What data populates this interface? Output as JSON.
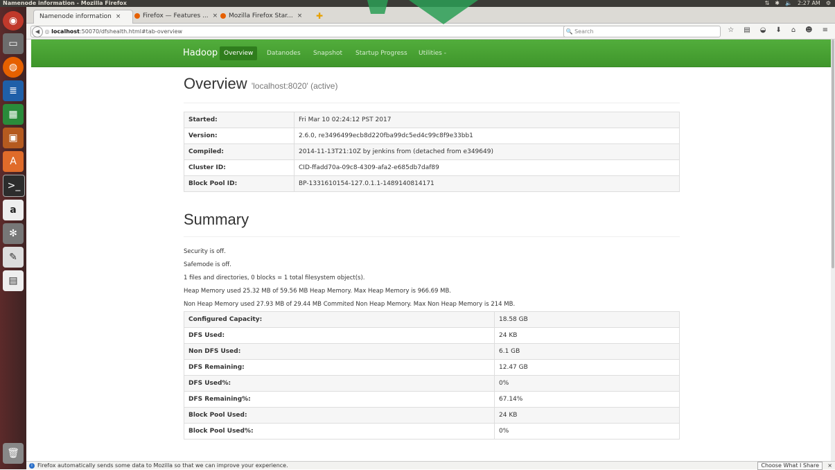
{
  "system_bar": {
    "title": "Namenode information - Mozilla Firefox",
    "time": "2:27 AM"
  },
  "launcher": {
    "items": [
      "ubuntu-home-icon",
      "files-icon",
      "firefox-icon",
      "writer-icon",
      "calc-icon",
      "impress-icon",
      "software-center-icon",
      "terminal-icon",
      "amazon-icon",
      "settings-icon",
      "text-editor-icon",
      "save-icon",
      "trash-icon"
    ]
  },
  "tabs": [
    {
      "label": "Namenode information"
    },
    {
      "label": "Firefox — Features ..."
    },
    {
      "label": "Mozilla Firefox Star..."
    }
  ],
  "url": {
    "host": "localhost",
    "path": ":50070/dfshealth.html#tab-overview"
  },
  "search": {
    "placeholder": "Search"
  },
  "hadoop_nav": {
    "brand": "Hadoop",
    "items": [
      "Overview",
      "Datanodes",
      "Snapshot",
      "Startup Progress",
      "Utilities -"
    ]
  },
  "overview": {
    "title": "Overview",
    "subtitle": "'localhost:8020' (active)",
    "rows": [
      {
        "k": "Started:",
        "v": "Fri Mar 10 02:24:12 PST 2017"
      },
      {
        "k": "Version:",
        "v": "2.6.0, re3496499ecb8d220fba99dc5ed4c99c8f9e33bb1"
      },
      {
        "k": "Compiled:",
        "v": "2014-11-13T21:10Z by jenkins from (detached from e349649)"
      },
      {
        "k": "Cluster ID:",
        "v": "CID-ffadd70a-09c8-4309-afa2-e685db7daf89"
      },
      {
        "k": "Block Pool ID:",
        "v": "BP-1331610154-127.0.1.1-1489140814171"
      }
    ]
  },
  "summary": {
    "title": "Summary",
    "lines": [
      "Security is off.",
      "Safemode is off.",
      "1 files and directories, 0 blocks = 1 total filesystem object(s).",
      "Heap Memory used 25.32 MB of 59.56 MB Heap Memory. Max Heap Memory is 966.69 MB.",
      "Non Heap Memory used 27.93 MB of 29.44 MB Commited Non Heap Memory. Max Non Heap Memory is 214 MB."
    ],
    "rows": [
      {
        "k": "Configured Capacity:",
        "v": "18.58 GB"
      },
      {
        "k": "DFS Used:",
        "v": "24 KB"
      },
      {
        "k": "Non DFS Used:",
        "v": "6.1 GB"
      },
      {
        "k": "DFS Remaining:",
        "v": "12.47 GB"
      },
      {
        "k": "DFS Used%:",
        "v": "0%"
      },
      {
        "k": "DFS Remaining%:",
        "v": "67.14%"
      },
      {
        "k": "Block Pool Used:",
        "v": "24 KB"
      },
      {
        "k": "Block Pool Used%:",
        "v": "0%"
      }
    ]
  },
  "notice": {
    "text": "Firefox automatically sends some data to Mozilla so that we can improve your experience.",
    "button": "Choose What I Share"
  }
}
